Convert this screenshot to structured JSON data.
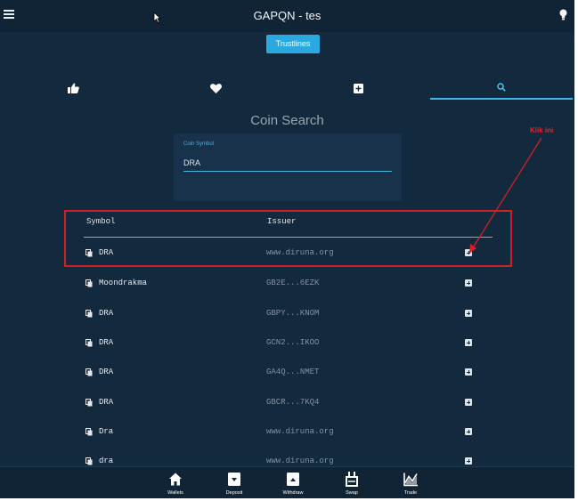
{
  "header": {
    "title": "GAPQN - tes",
    "menu_icon": "hamburger-icon",
    "theme_icon": "lightbulb-icon"
  },
  "trustlines_button": "Trustlines",
  "tabs": [
    {
      "icon": "thumbs-up-icon",
      "active": false
    },
    {
      "icon": "heart-icon",
      "active": false
    },
    {
      "icon": "plus-square-icon",
      "active": false
    },
    {
      "icon": "search-icon",
      "active": true
    }
  ],
  "coin_search": {
    "title": "Coin Search",
    "field_label": "Coin Symbol",
    "value": "DRA"
  },
  "table": {
    "columns": [
      "Symbol",
      "Issuer"
    ],
    "rows": [
      {
        "symbol": "DRA",
        "issuer": "www.diruna.org"
      },
      {
        "symbol": "Moondrakma",
        "issuer": "GB2E...6EZK"
      },
      {
        "symbol": "DRA",
        "issuer": "GBPY...KNOM"
      },
      {
        "symbol": "DRA",
        "issuer": "GCN2...IKOO"
      },
      {
        "symbol": "DRA",
        "issuer": "GA4Q...NMET"
      },
      {
        "symbol": "DRA",
        "issuer": "GBCR...7KQ4"
      },
      {
        "symbol": "Dra",
        "issuer": "www.diruna.org"
      },
      {
        "symbol": "dra",
        "issuer": "www.diruna.org"
      }
    ]
  },
  "annotation": {
    "text": "Klik ini",
    "color": "#cc2227"
  },
  "bottom_nav": [
    {
      "label": "Wallets",
      "icon": "home-icon"
    },
    {
      "label": "Deposit",
      "icon": "deposit-icon"
    },
    {
      "label": "Withdraw",
      "icon": "withdraw-icon"
    },
    {
      "label": "Swap",
      "icon": "swap-icon"
    },
    {
      "label": "Trade",
      "icon": "trade-chart-icon"
    }
  ],
  "colors": {
    "background": "#13293d",
    "accent": "#2aa9e0",
    "highlight": "#cc2227"
  }
}
